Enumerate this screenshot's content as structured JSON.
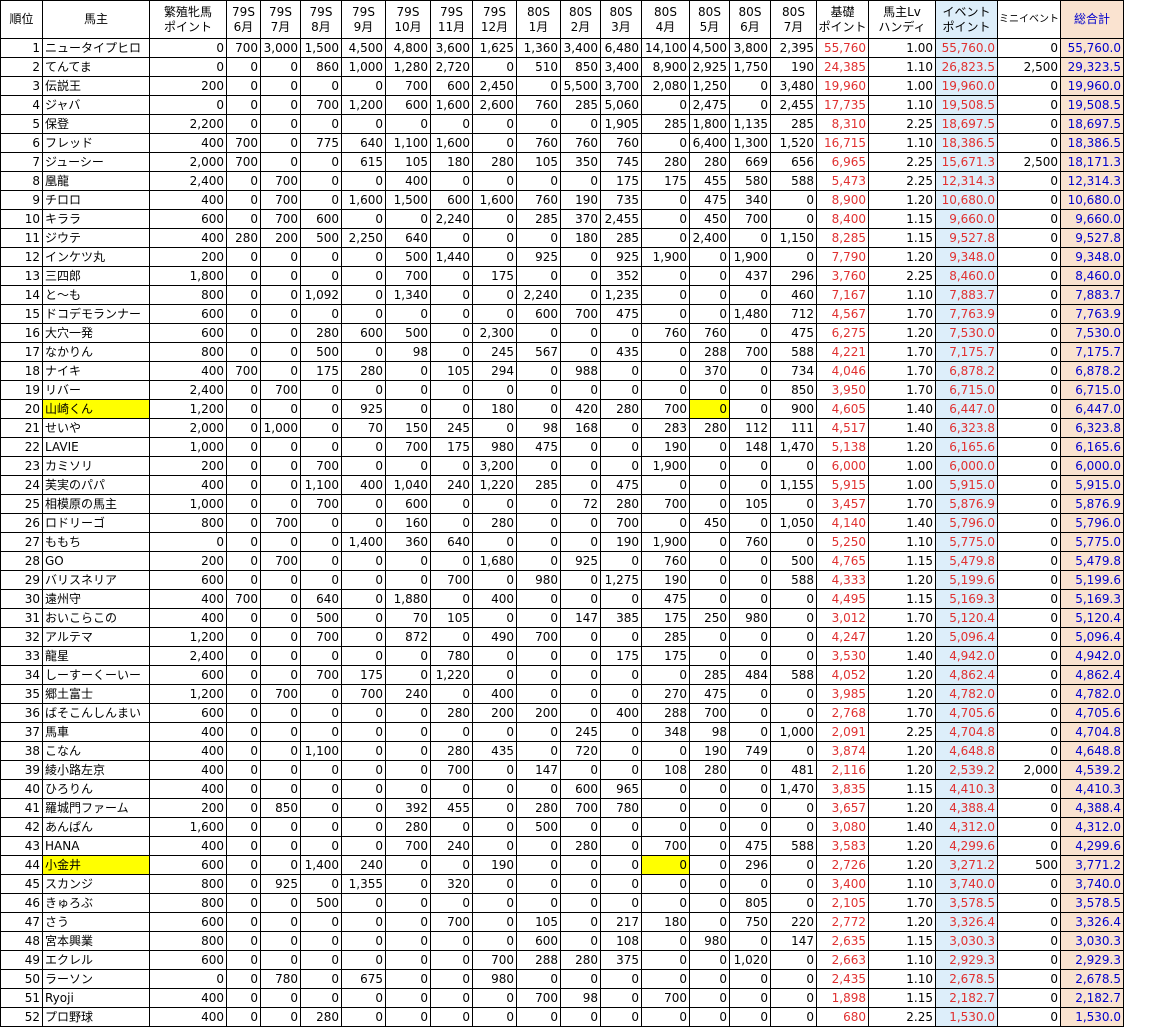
{
  "headers": [
    "順位",
    "馬主",
    "繁殖牝馬\nポイント",
    "79S\n6月",
    "79S\n7月",
    "79S\n8月",
    "79S\n9月",
    "79S\n10月",
    "79S\n11月",
    "79S\n12月",
    "80S\n1月",
    "80S\n2月",
    "80S\n3月",
    "80S\n4月",
    "80S\n5月",
    "80S\n6月",
    "80S\n7月",
    "基礎\nポイント",
    "馬主Lv\nハンディ",
    "イベント\nポイント",
    "ミニイベント",
    "総合計"
  ],
  "highlight_color": "#ffff00",
  "rows": [
    [
      "1",
      "ニュータイプヒロ",
      "0",
      "700",
      "3,000",
      "1,500",
      "4,500",
      "4,800",
      "3,600",
      "1,625",
      "1,360",
      "3,400",
      "6,480",
      "14,100",
      "4,500",
      "3,800",
      "2,395",
      "55,760",
      "1.00",
      "55,760.0",
      "0",
      "55,760.0"
    ],
    [
      "2",
      "てんてま",
      "0",
      "0",
      "0",
      "860",
      "1,000",
      "1,280",
      "2,720",
      "0",
      "510",
      "850",
      "3,400",
      "8,900",
      "2,925",
      "1,750",
      "190",
      "24,385",
      "1.10",
      "26,823.5",
      "2,500",
      "29,323.5"
    ],
    [
      "3",
      "伝説王",
      "200",
      "0",
      "0",
      "0",
      "0",
      "700",
      "600",
      "2,450",
      "0",
      "5,500",
      "3,700",
      "2,080",
      "1,250",
      "0",
      "3,480",
      "19,960",
      "1.00",
      "19,960.0",
      "0",
      "19,960.0"
    ],
    [
      "4",
      "ジャバ",
      "0",
      "0",
      "0",
      "700",
      "1,200",
      "600",
      "1,600",
      "2,600",
      "760",
      "285",
      "5,060",
      "0",
      "2,475",
      "0",
      "2,455",
      "17,735",
      "1.10",
      "19,508.5",
      "0",
      "19,508.5"
    ],
    [
      "5",
      "保登",
      "2,200",
      "0",
      "0",
      "0",
      "0",
      "0",
      "0",
      "0",
      "0",
      "0",
      "1,905",
      "285",
      "1,800",
      "1,135",
      "285",
      "8,310",
      "2.25",
      "18,697.5",
      "0",
      "18,697.5"
    ],
    [
      "6",
      "フレッド",
      "400",
      "700",
      "0",
      "775",
      "640",
      "1,100",
      "1,600",
      "0",
      "760",
      "760",
      "760",
      "0",
      "6,400",
      "1,300",
      "1,520",
      "16,715",
      "1.10",
      "18,386.5",
      "0",
      "18,386.5"
    ],
    [
      "7",
      "ジューシー",
      "2,000",
      "700",
      "0",
      "0",
      "615",
      "105",
      "180",
      "280",
      "105",
      "350",
      "745",
      "280",
      "280",
      "669",
      "656",
      "6,965",
      "2.25",
      "15,671.3",
      "2,500",
      "18,171.3"
    ],
    [
      "8",
      "凰龍",
      "2,400",
      "0",
      "700",
      "0",
      "0",
      "400",
      "0",
      "0",
      "0",
      "0",
      "175",
      "175",
      "455",
      "580",
      "588",
      "5,473",
      "2.25",
      "12,314.3",
      "0",
      "12,314.3"
    ],
    [
      "9",
      "チロロ",
      "400",
      "0",
      "700",
      "0",
      "1,600",
      "1,500",
      "600",
      "1,600",
      "760",
      "190",
      "735",
      "0",
      "475",
      "340",
      "0",
      "8,900",
      "1.20",
      "10,680.0",
      "0",
      "10,680.0"
    ],
    [
      "10",
      "キララ",
      "600",
      "0",
      "700",
      "600",
      "0",
      "0",
      "2,240",
      "0",
      "285",
      "370",
      "2,455",
      "0",
      "450",
      "700",
      "0",
      "8,400",
      "1.15",
      "9,660.0",
      "0",
      "9,660.0"
    ],
    [
      "11",
      "ジウテ",
      "400",
      "280",
      "200",
      "500",
      "2,250",
      "640",
      "0",
      "0",
      "0",
      "180",
      "285",
      "0",
      "2,400",
      "0",
      "1,150",
      "8,285",
      "1.15",
      "9,527.8",
      "0",
      "9,527.8"
    ],
    [
      "12",
      "インケツ丸",
      "200",
      "0",
      "0",
      "0",
      "0",
      "500",
      "1,440",
      "0",
      "925",
      "0",
      "925",
      "1,900",
      "0",
      "1,900",
      "0",
      "7,790",
      "1.20",
      "9,348.0",
      "0",
      "9,348.0"
    ],
    [
      "13",
      "三四郎",
      "1,800",
      "0",
      "0",
      "0",
      "0",
      "700",
      "0",
      "175",
      "0",
      "0",
      "352",
      "0",
      "0",
      "437",
      "296",
      "3,760",
      "2.25",
      "8,460.0",
      "0",
      "8,460.0"
    ],
    [
      "14",
      "と～も",
      "800",
      "0",
      "0",
      "1,092",
      "0",
      "1,340",
      "0",
      "0",
      "2,240",
      "0",
      "1,235",
      "0",
      "0",
      "0",
      "460",
      "7,167",
      "1.10",
      "7,883.7",
      "0",
      "7,883.7"
    ],
    [
      "15",
      "ドコデモランナー",
      "600",
      "0",
      "0",
      "0",
      "0",
      "0",
      "0",
      "0",
      "600",
      "700",
      "475",
      "0",
      "0",
      "1,480",
      "712",
      "4,567",
      "1.70",
      "7,763.9",
      "0",
      "7,763.9"
    ],
    [
      "16",
      "大穴一発",
      "600",
      "0",
      "0",
      "280",
      "600",
      "500",
      "0",
      "2,300",
      "0",
      "0",
      "0",
      "760",
      "760",
      "0",
      "475",
      "6,275",
      "1.20",
      "7,530.0",
      "0",
      "7,530.0"
    ],
    [
      "17",
      "なかりん",
      "800",
      "0",
      "0",
      "500",
      "0",
      "98",
      "0",
      "245",
      "567",
      "0",
      "435",
      "0",
      "288",
      "700",
      "588",
      "4,221",
      "1.70",
      "7,175.7",
      "0",
      "7,175.7"
    ],
    [
      "18",
      "ナイキ",
      "400",
      "700",
      "0",
      "175",
      "280",
      "0",
      "105",
      "294",
      "0",
      "988",
      "0",
      "0",
      "370",
      "0",
      "734",
      "4,046",
      "1.70",
      "6,878.2",
      "0",
      "6,878.2"
    ],
    [
      "19",
      "リバー",
      "2,400",
      "0",
      "700",
      "0",
      "0",
      "0",
      "0",
      "0",
      "0",
      "0",
      "0",
      "0",
      "0",
      "0",
      "850",
      "3,950",
      "1.70",
      "6,715.0",
      "0",
      "6,715.0"
    ],
    [
      "20",
      "山崎くん",
      "1,200",
      "0",
      "0",
      "0",
      "925",
      "0",
      "0",
      "180",
      "0",
      "420",
      "280",
      "700",
      "0",
      "0",
      "900",
      "4,605",
      "1.40",
      "6,447.0",
      "0",
      "6,447.0"
    ],
    [
      "21",
      "せいや",
      "2,000",
      "0",
      "1,000",
      "0",
      "70",
      "150",
      "245",
      "0",
      "98",
      "168",
      "0",
      "283",
      "280",
      "112",
      "111",
      "4,517",
      "1.40",
      "6,323.8",
      "0",
      "6,323.8"
    ],
    [
      "22",
      "LAVIE",
      "1,000",
      "0",
      "0",
      "0",
      "0",
      "700",
      "175",
      "980",
      "475",
      "0",
      "0",
      "190",
      "0",
      "148",
      "1,470",
      "5,138",
      "1.20",
      "6,165.6",
      "0",
      "6,165.6"
    ],
    [
      "23",
      "カミソリ",
      "200",
      "0",
      "0",
      "700",
      "0",
      "0",
      "0",
      "3,200",
      "0",
      "0",
      "0",
      "1,900",
      "0",
      "0",
      "0",
      "6,000",
      "1.00",
      "6,000.0",
      "0",
      "6,000.0"
    ],
    [
      "24",
      "芙実のパパ",
      "400",
      "0",
      "0",
      "1,100",
      "400",
      "1,040",
      "240",
      "1,220",
      "285",
      "0",
      "475",
      "0",
      "0",
      "0",
      "1,155",
      "5,915",
      "1.00",
      "5,915.0",
      "0",
      "5,915.0"
    ],
    [
      "25",
      "相模原の馬主",
      "1,000",
      "0",
      "0",
      "700",
      "0",
      "600",
      "0",
      "0",
      "0",
      "72",
      "280",
      "700",
      "0",
      "105",
      "0",
      "3,457",
      "1.70",
      "5,876.9",
      "0",
      "5,876.9"
    ],
    [
      "26",
      "ロドリーゴ",
      "800",
      "0",
      "700",
      "0",
      "0",
      "160",
      "0",
      "280",
      "0",
      "0",
      "700",
      "0",
      "450",
      "0",
      "1,050",
      "4,140",
      "1.40",
      "5,796.0",
      "0",
      "5,796.0"
    ],
    [
      "27",
      "ももち",
      "0",
      "0",
      "0",
      "0",
      "1,400",
      "360",
      "640",
      "0",
      "0",
      "0",
      "190",
      "1,900",
      "0",
      "760",
      "0",
      "5,250",
      "1.10",
      "5,775.0",
      "0",
      "5,775.0"
    ],
    [
      "28",
      "GO",
      "200",
      "0",
      "700",
      "0",
      "0",
      "0",
      "0",
      "1,680",
      "0",
      "925",
      "0",
      "760",
      "0",
      "0",
      "500",
      "4,765",
      "1.15",
      "5,479.8",
      "0",
      "5,479.8"
    ],
    [
      "29",
      "バリスネリア",
      "600",
      "0",
      "0",
      "0",
      "0",
      "0",
      "700",
      "0",
      "980",
      "0",
      "1,275",
      "190",
      "0",
      "0",
      "588",
      "4,333",
      "1.20",
      "5,199.6",
      "0",
      "5,199.6"
    ],
    [
      "30",
      "遠州守",
      "400",
      "700",
      "0",
      "640",
      "0",
      "1,880",
      "0",
      "400",
      "0",
      "0",
      "0",
      "475",
      "0",
      "0",
      "0",
      "4,495",
      "1.15",
      "5,169.3",
      "0",
      "5,169.3"
    ],
    [
      "31",
      "おいこらこの",
      "400",
      "0",
      "0",
      "500",
      "0",
      "70",
      "105",
      "0",
      "0",
      "147",
      "385",
      "175",
      "250",
      "980",
      "0",
      "3,012",
      "1.70",
      "5,120.4",
      "0",
      "5,120.4"
    ],
    [
      "32",
      "アルテマ",
      "1,200",
      "0",
      "0",
      "700",
      "0",
      "872",
      "0",
      "490",
      "700",
      "0",
      "0",
      "285",
      "0",
      "0",
      "0",
      "4,247",
      "1.20",
      "5,096.4",
      "0",
      "5,096.4"
    ],
    [
      "33",
      "龍星",
      "2,400",
      "0",
      "0",
      "0",
      "0",
      "0",
      "780",
      "0",
      "0",
      "0",
      "175",
      "175",
      "0",
      "0",
      "0",
      "3,530",
      "1.40",
      "4,942.0",
      "0",
      "4,942.0"
    ],
    [
      "34",
      "しーすーくーいー",
      "600",
      "0",
      "0",
      "700",
      "175",
      "0",
      "1,220",
      "0",
      "0",
      "0",
      "0",
      "0",
      "285",
      "484",
      "588",
      "4,052",
      "1.20",
      "4,862.4",
      "0",
      "4,862.4"
    ],
    [
      "35",
      "郷土富士",
      "1,200",
      "0",
      "700",
      "0",
      "700",
      "240",
      "0",
      "400",
      "0",
      "0",
      "0",
      "270",
      "475",
      "0",
      "0",
      "3,985",
      "1.20",
      "4,782.0",
      "0",
      "4,782.0"
    ],
    [
      "36",
      "ばそこんしんまい",
      "600",
      "0",
      "0",
      "0",
      "0",
      "0",
      "280",
      "200",
      "200",
      "0",
      "400",
      "288",
      "700",
      "0",
      "0",
      "2,768",
      "1.70",
      "4,705.6",
      "0",
      "4,705.6"
    ],
    [
      "37",
      "馬車",
      "400",
      "0",
      "0",
      "0",
      "0",
      "0",
      "0",
      "0",
      "0",
      "245",
      "0",
      "348",
      "98",
      "0",
      "1,000",
      "2,091",
      "2.25",
      "4,704.8",
      "0",
      "4,704.8"
    ],
    [
      "38",
      "こなん",
      "400",
      "0",
      "0",
      "1,100",
      "0",
      "0",
      "280",
      "435",
      "0",
      "720",
      "0",
      "0",
      "190",
      "749",
      "0",
      "3,874",
      "1.20",
      "4,648.8",
      "0",
      "4,648.8"
    ],
    [
      "39",
      "綾小路左京",
      "400",
      "0",
      "0",
      "0",
      "0",
      "0",
      "700",
      "0",
      "147",
      "0",
      "0",
      "108",
      "280",
      "0",
      "481",
      "2,116",
      "1.20",
      "2,539.2",
      "2,000",
      "4,539.2"
    ],
    [
      "40",
      "ひろりん",
      "400",
      "0",
      "0",
      "0",
      "0",
      "0",
      "0",
      "0",
      "0",
      "600",
      "965",
      "0",
      "0",
      "0",
      "1,470",
      "3,835",
      "1.15",
      "4,410.3",
      "0",
      "4,410.3"
    ],
    [
      "41",
      "羅城門ファーム",
      "200",
      "0",
      "850",
      "0",
      "0",
      "392",
      "455",
      "0",
      "280",
      "700",
      "780",
      "0",
      "0",
      "0",
      "0",
      "3,657",
      "1.20",
      "4,388.4",
      "0",
      "4,388.4"
    ],
    [
      "42",
      "あんぱん",
      "1,600",
      "0",
      "0",
      "0",
      "0",
      "280",
      "0",
      "0",
      "500",
      "0",
      "0",
      "0",
      "0",
      "0",
      "0",
      "3,080",
      "1.40",
      "4,312.0",
      "0",
      "4,312.0"
    ],
    [
      "43",
      "HANA",
      "400",
      "0",
      "0",
      "0",
      "0",
      "700",
      "240",
      "0",
      "0",
      "280",
      "0",
      "700",
      "0",
      "475",
      "588",
      "3,583",
      "1.20",
      "4,299.6",
      "0",
      "4,299.6"
    ],
    [
      "44",
      "小金井",
      "600",
      "0",
      "0",
      "1,400",
      "240",
      "0",
      "0",
      "190",
      "0",
      "0",
      "0",
      "0",
      "0",
      "296",
      "0",
      "2,726",
      "1.20",
      "3,271.2",
      "500",
      "3,771.2"
    ],
    [
      "45",
      "スカンジ",
      "800",
      "0",
      "925",
      "0",
      "1,355",
      "0",
      "320",
      "0",
      "0",
      "0",
      "0",
      "0",
      "0",
      "0",
      "0",
      "3,400",
      "1.10",
      "3,740.0",
      "0",
      "3,740.0"
    ],
    [
      "46",
      "きゅろぶ",
      "800",
      "0",
      "0",
      "500",
      "0",
      "0",
      "0",
      "0",
      "0",
      "0",
      "0",
      "0",
      "0",
      "805",
      "0",
      "2,105",
      "1.70",
      "3,578.5",
      "0",
      "3,578.5"
    ],
    [
      "47",
      "さう",
      "600",
      "0",
      "0",
      "0",
      "0",
      "0",
      "700",
      "0",
      "105",
      "0",
      "217",
      "180",
      "0",
      "750",
      "220",
      "2,772",
      "1.20",
      "3,326.4",
      "0",
      "3,326.4"
    ],
    [
      "48",
      "宮本興業",
      "800",
      "0",
      "0",
      "0",
      "0",
      "0",
      "0",
      "0",
      "600",
      "0",
      "108",
      "0",
      "980",
      "0",
      "147",
      "2,635",
      "1.15",
      "3,030.3",
      "0",
      "3,030.3"
    ],
    [
      "49",
      "エクレル",
      "600",
      "0",
      "0",
      "0",
      "0",
      "0",
      "0",
      "700",
      "288",
      "280",
      "375",
      "0",
      "0",
      "1,020",
      "0",
      "2,663",
      "1.10",
      "2,929.3",
      "0",
      "2,929.3"
    ],
    [
      "50",
      "ラーソン",
      "0",
      "0",
      "780",
      "0",
      "675",
      "0",
      "0",
      "980",
      "0",
      "0",
      "0",
      "0",
      "0",
      "0",
      "0",
      "2,435",
      "1.10",
      "2,678.5",
      "0",
      "2,678.5"
    ],
    [
      "51",
      "Ryoji",
      "400",
      "0",
      "0",
      "0",
      "0",
      "0",
      "0",
      "0",
      "700",
      "98",
      "0",
      "700",
      "0",
      "0",
      "0",
      "1,898",
      "1.15",
      "2,182.7",
      "0",
      "2,182.7"
    ],
    [
      "52",
      "プロ野球",
      "400",
      "0",
      "0",
      "280",
      "0",
      "0",
      "0",
      "0",
      "0",
      "0",
      "0",
      "0",
      "0",
      "0",
      "0",
      "680",
      "2.25",
      "1,530.0",
      "0",
      "1,530.0"
    ]
  ],
  "highlights": [
    {
      "row": 20,
      "col": 1
    },
    {
      "row": 20,
      "col": 14
    },
    {
      "row": 44,
      "col": 1
    },
    {
      "row": 44,
      "col": 13
    }
  ]
}
